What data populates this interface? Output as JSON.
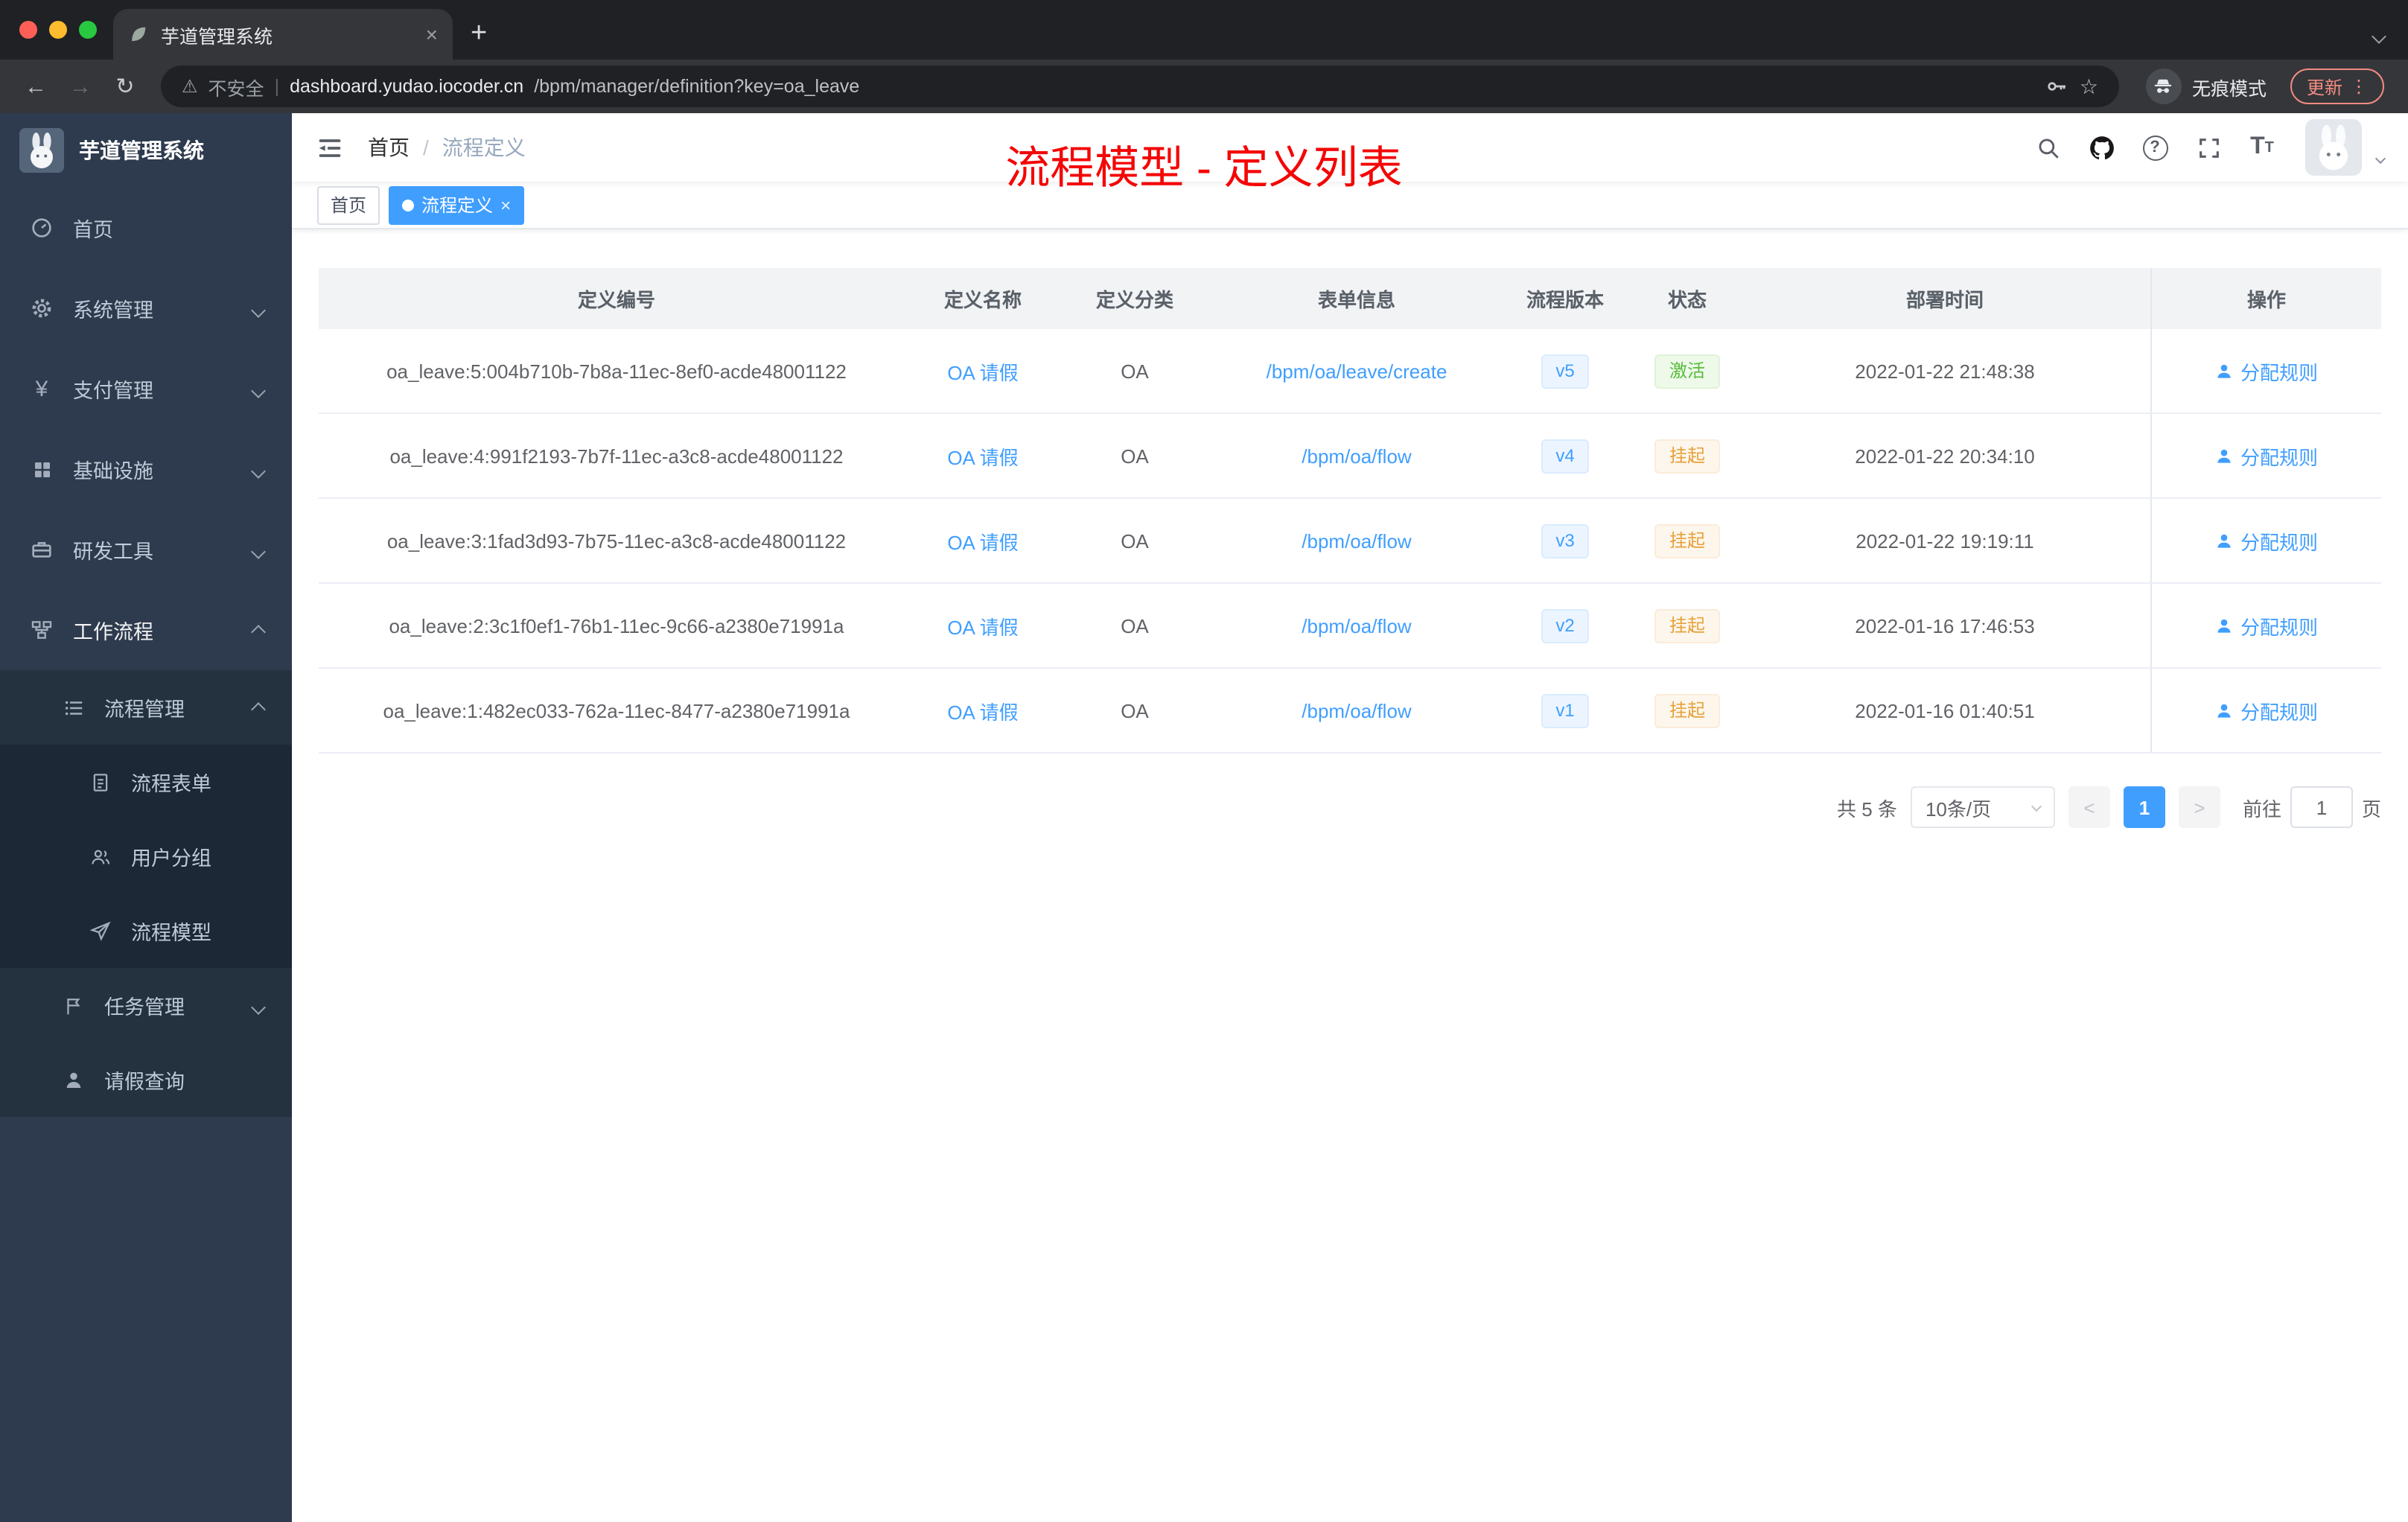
{
  "browser": {
    "tab_title": "芋道管理系统",
    "address": {
      "warning_label": "不安全",
      "domain": "dashboard.yudao.iocoder.cn",
      "path": "/bpm/manager/definition?key=oa_leave"
    },
    "incognito_label": "无痕模式",
    "update_label": "更新"
  },
  "glyphs": {
    "close": "×",
    "plus": "+",
    "back": "←",
    "forward": "→",
    "reload": "↻",
    "warning": "⚠",
    "divider": "|",
    "star": "☆",
    "more": "⋮",
    "question": "?",
    "yen": "¥",
    "font_large": "T",
    "font_small": "T",
    "prev": "<",
    "next": ">",
    "slash": "/"
  },
  "sidebar": {
    "logo_title": "芋道管理系统",
    "items": [
      {
        "label": "首页",
        "icon": "dashboard-icon"
      },
      {
        "label": "系统管理",
        "icon": "gear-icon"
      },
      {
        "label": "支付管理",
        "icon": "yen-icon"
      },
      {
        "label": "基础设施",
        "icon": "grid-icon"
      },
      {
        "label": "研发工具",
        "icon": "toolbox-icon"
      },
      {
        "label": "工作流程",
        "icon": "workflow-icon"
      },
      {
        "label": "流程管理",
        "icon": "list-icon"
      },
      {
        "label": "流程表单",
        "icon": "form-icon"
      },
      {
        "label": "用户分组",
        "icon": "user-group-icon"
      },
      {
        "label": "流程模型",
        "icon": "paper-plane-icon"
      },
      {
        "label": "任务管理",
        "icon": "flag-icon"
      },
      {
        "label": "请假查询",
        "icon": "person-icon"
      }
    ]
  },
  "header": {
    "breadcrumb_home": "首页",
    "breadcrumb_current": "流程定义",
    "overlay_title": "流程模型 - 定义列表"
  },
  "tags": {
    "home_label": "首页",
    "active_label": "流程定义"
  },
  "table": {
    "columns": [
      "定义编号",
      "定义名称",
      "定义分类",
      "表单信息",
      "流程版本",
      "状态",
      "部署时间",
      "操作"
    ],
    "rows": [
      {
        "id": "oa_leave:5:004b710b-7b8a-11ec-8ef0-acde48001122",
        "name": "OA 请假",
        "category": "OA",
        "form": "/bpm/oa/leave/create",
        "version": "v5",
        "status": "激活",
        "time": "2022-01-22 21:48:38",
        "action": "分配规则"
      },
      {
        "id": "oa_leave:4:991f2193-7b7f-11ec-a3c8-acde48001122",
        "name": "OA 请假",
        "category": "OA",
        "form": "/bpm/oa/flow",
        "version": "v4",
        "status": "挂起",
        "time": "2022-01-22 20:34:10",
        "action": "分配规则"
      },
      {
        "id": "oa_leave:3:1fad3d93-7b75-11ec-a3c8-acde48001122",
        "name": "OA 请假",
        "category": "OA",
        "form": "/bpm/oa/flow",
        "version": "v3",
        "status": "挂起",
        "time": "2022-01-22 19:19:11",
        "action": "分配规则"
      },
      {
        "id": "oa_leave:2:3c1f0ef1-76b1-11ec-9c66-a2380e71991a",
        "name": "OA 请假",
        "category": "OA",
        "form": "/bpm/oa/flow",
        "version": "v2",
        "status": "挂起",
        "time": "2022-01-16 17:46:53",
        "action": "分配规则"
      },
      {
        "id": "oa_leave:1:482ec033-762a-11ec-8477-a2380e71991a",
        "name": "OA 请假",
        "category": "OA",
        "form": "/bpm/oa/flow",
        "version": "v1",
        "status": "挂起",
        "time": "2022-01-16 01:40:51",
        "action": "分配规则"
      }
    ]
  },
  "pagination": {
    "total_label": "共 5 条",
    "page_size_label": "10条/页",
    "current_page": "1",
    "goto_label": "前往",
    "goto_value": "1",
    "page_unit": "页"
  }
}
